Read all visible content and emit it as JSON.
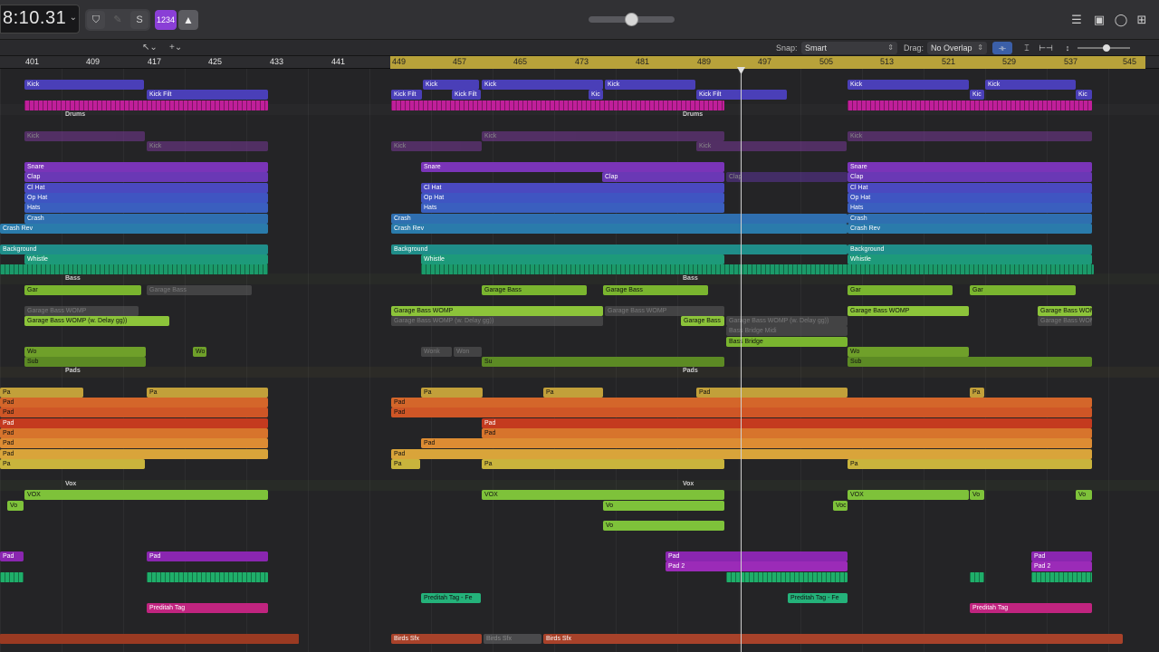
{
  "control_bar": {
    "lcd_time": "8:10.31",
    "count_in_label": "1234",
    "icons": [
      "shield-icon",
      "pencil-icon",
      "dollar-icon",
      "metronome-icon",
      "list-icon",
      "note-icon",
      "browser-icon",
      "library-icon"
    ]
  },
  "toolbar": {
    "snap_label": "Snap:",
    "snap_value": "Smart",
    "drag_label": "Drag:",
    "drag_value": "No Overlap"
  },
  "ruler": {
    "bars": [
      "401",
      "409",
      "417",
      "425",
      "433",
      "441",
      "449",
      "457",
      "465",
      "473",
      "481",
      "489",
      "497",
      "505",
      "513",
      "521",
      "529",
      "537",
      "545"
    ]
  },
  "folders": {
    "drums": "Drums",
    "bass": "Bass",
    "pads": "Pads",
    "vox": "Vox"
  },
  "regions": {
    "kick": "Kick",
    "kick_filt": "Kick Filt",
    "kic": "Kic",
    "snare": "Snare",
    "sn": "Sn",
    "clap": "Clap",
    "cl_hat": "Cl Hat",
    "op_hat": "Op Hat",
    "hats": "Hats",
    "crash": "Crash",
    "crash_rev": "Crash Rev",
    "background": "Background",
    "whistle": "Whistle",
    "garage_bass": "Garage Bass",
    "gar": "Gar",
    "garage_bass_womp": "Garage Bass WOMP",
    "garage_bass_womp_delay": "Garage Bass WOMP (w. Delay gg))",
    "bass_bridge_midi": "Bass Bridge Midi",
    "bass_bridge": "Bass Bridge",
    "wo": "Wo",
    "wonk": "Wonk",
    "won": "Won",
    "sub": "Sub",
    "su": "Su",
    "pad": "Pad",
    "pa": "Pa",
    "vox_region": "VOX",
    "vo": "Vo",
    "voc": "Voc",
    "pad_main": "Pad",
    "pad_2": "Pad 2",
    "preditah_tag": "Preditah Tag",
    "preditah_tag_fe": "Preditah Tag - Fe",
    "birds_sfx": "Birds Sfx"
  }
}
